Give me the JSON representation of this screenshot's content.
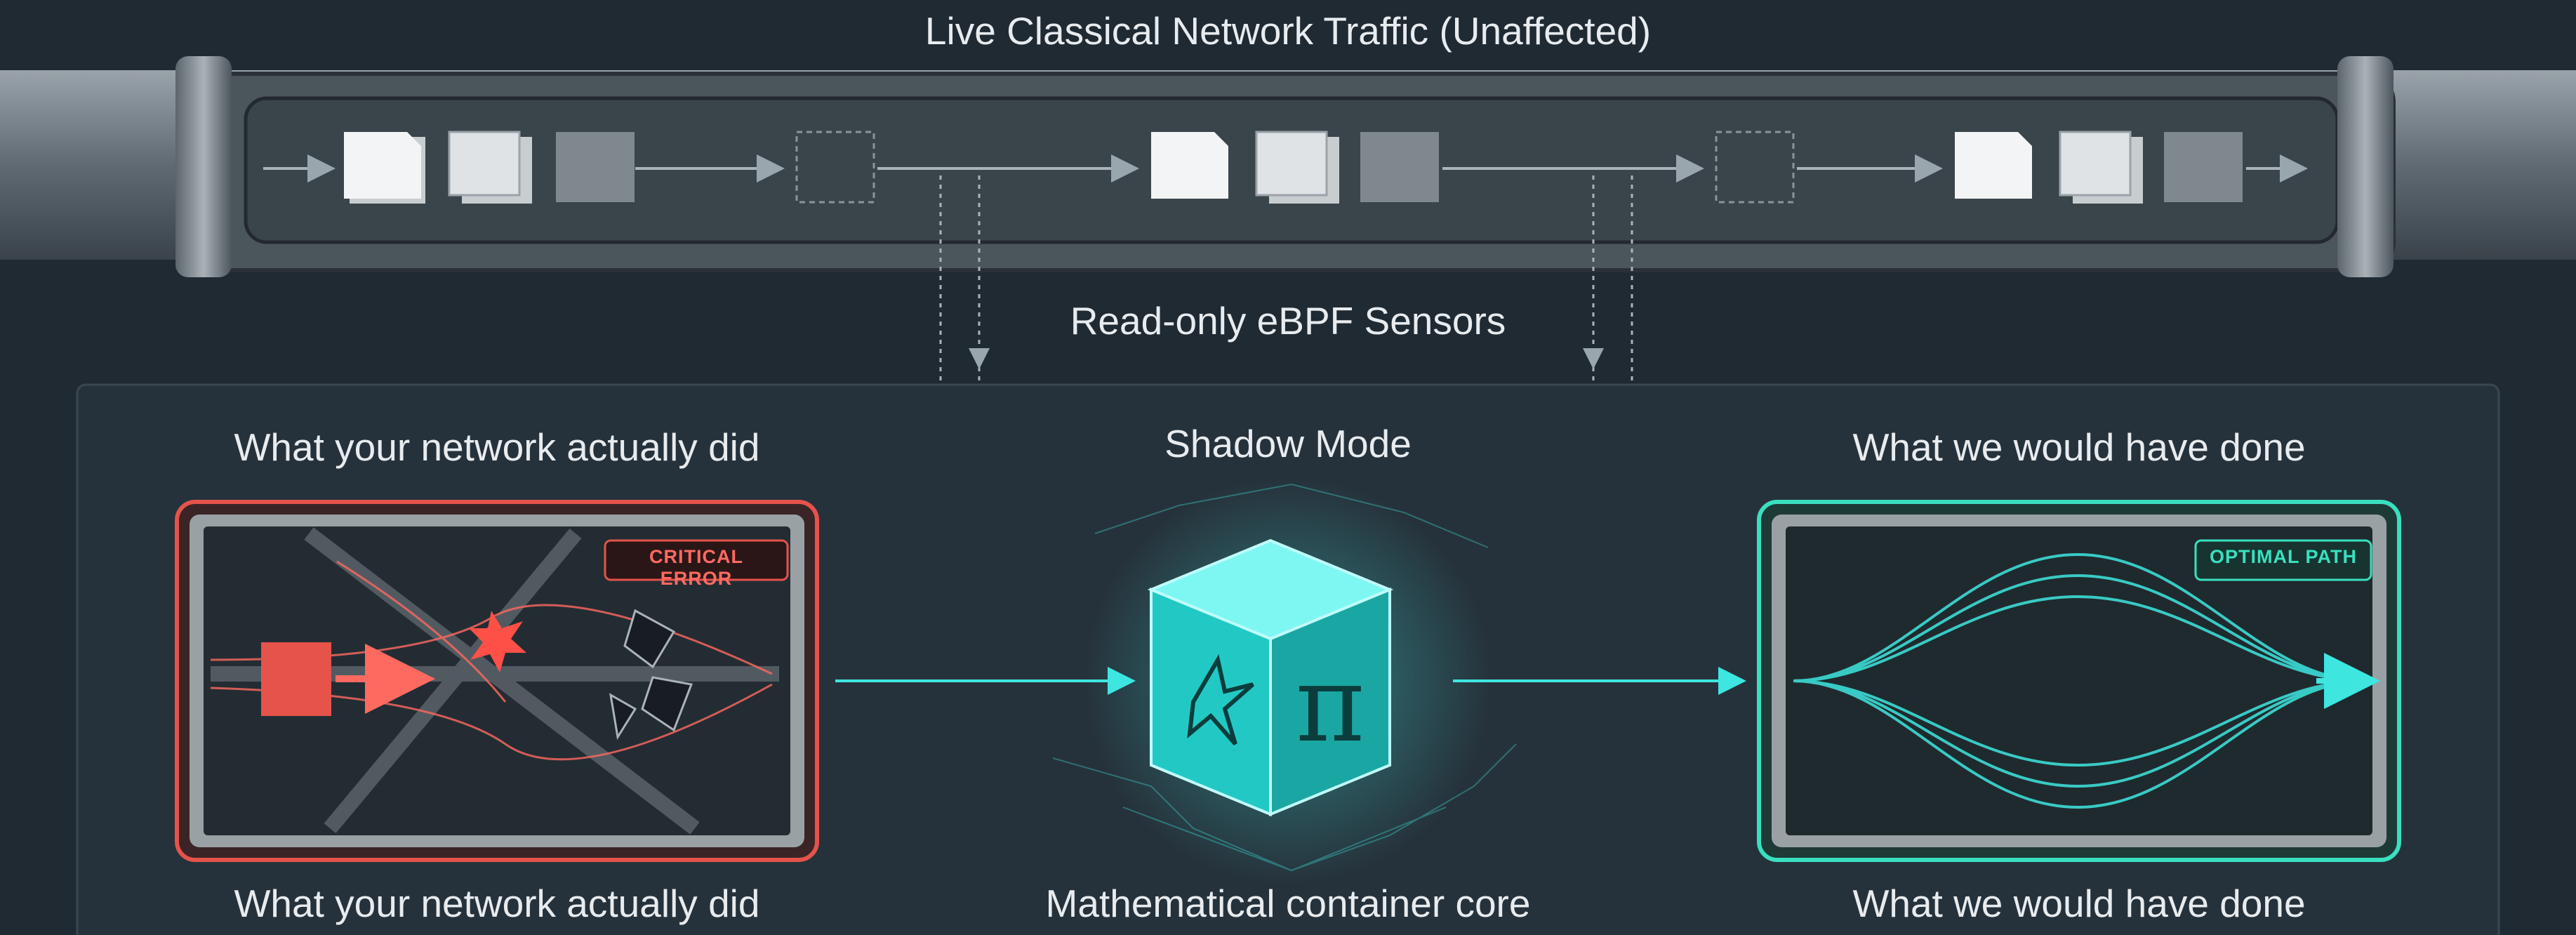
{
  "header": {
    "title": "Live Classical Network Traffic (Unaffected)"
  },
  "sensors": {
    "label": "Read-only eBPF Sensors"
  },
  "panels": {
    "left": {
      "top_label": "What your network actually did",
      "bottom_label": "What your network actually did",
      "badge": "CRITICAL ERROR",
      "accent": "#e5534b"
    },
    "center": {
      "top_label": "Shadow Mode",
      "bottom_label": "Mathematical container core",
      "symbol": "π",
      "accent": "#3ee6e0"
    },
    "right": {
      "top_label": "What we would have done",
      "bottom_label": "What we would have done",
      "badge": "OPTIMAL PATH",
      "accent": "#39e0bf"
    }
  },
  "icons": [
    "packet-icon",
    "sensor-arrow-icon",
    "explosion-icon",
    "broken-glass-icon",
    "cube-icon",
    "pi-icon",
    "star-glyph-icon"
  ]
}
